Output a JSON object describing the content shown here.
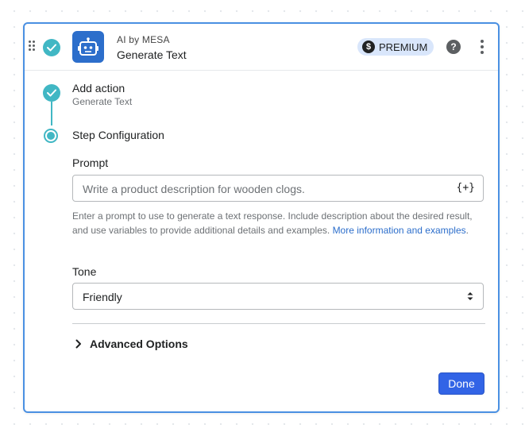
{
  "header": {
    "app_name": "AI by MESA",
    "action_name": "Generate Text",
    "badge_label": "PREMIUM",
    "badge_icon": "dollar-icon",
    "help_icon_glyph": "?",
    "dollar_glyph": "$"
  },
  "steps": [
    {
      "title": "Add action",
      "subtitle": "Generate Text",
      "state": "complete"
    },
    {
      "title": "Step Configuration",
      "state": "current"
    }
  ],
  "form": {
    "prompt": {
      "label": "Prompt",
      "placeholder": "Write a product description for wooden clogs.",
      "variable_button": "{+}",
      "help_text": "Enter a prompt to use to generate a text response. Include description about the desired result, and use variables to provide additional details and examples.",
      "help_link": "More information and examples",
      "help_suffix": "."
    },
    "tone": {
      "label": "Tone",
      "selected": "Friendly"
    },
    "advanced_label": "Advanced Options"
  },
  "footer": {
    "done_label": "Done"
  },
  "colors": {
    "accent": "#41b7c4",
    "primary_button": "#3264e6",
    "card_border": "#4a90e2",
    "badge_bg": "#d9e6fb",
    "app_icon_bg": "#2c6ecb"
  }
}
